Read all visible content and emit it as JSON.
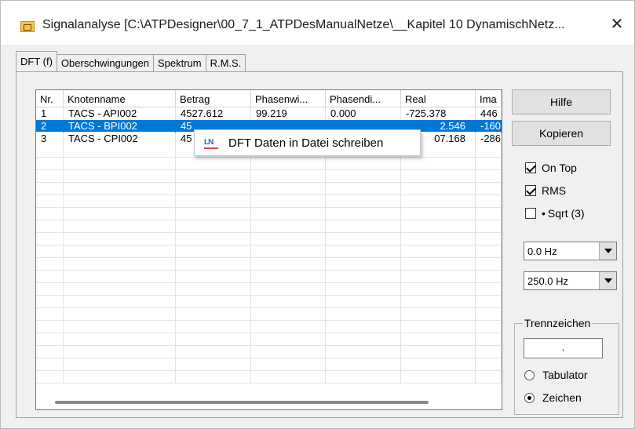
{
  "window": {
    "title": "Signalanalyse [C:\\ATPDesigner\\00_7_1_ATPDesManualNetze\\__Kapitel 10 DynamischNetz...",
    "close_symbol": "✕",
    "icon": "app-icon"
  },
  "tabs": [
    {
      "label": "DFT (f)",
      "active": true
    },
    {
      "label": "Oberschwingungen",
      "active": false
    },
    {
      "label": "Spektrum",
      "active": false
    },
    {
      "label": "R.M.S.",
      "active": false
    }
  ],
  "table": {
    "columns": [
      "Nr.",
      "Knotenname",
      "Betrag",
      "Phasenwi...",
      "Phasendi...",
      "Real",
      "Ima"
    ],
    "rows": [
      {
        "nr": "1",
        "name": "TACS - API002",
        "betrag": "4527.612",
        "phasenwinkel": "99.219",
        "phasendiff": "0.000",
        "real": "-725.378",
        "ima": "446"
      },
      {
        "nr": "2",
        "name": "TACS - BPI002",
        "betrag": "45",
        "phasenwinkel": "",
        "phasendiff": "",
        "real": "2.546",
        "ima": "-160",
        "selected": true
      },
      {
        "nr": "3",
        "name": "TACS - CPI002",
        "betrag": "45",
        "phasenwinkel": "",
        "phasendiff": "",
        "real": "07.168",
        "ima": "-286"
      }
    ]
  },
  "context_menu": {
    "item_label": "DFT Daten in Datei schreiben",
    "item_icon_text": "LN",
    "item_icon": "dft-file-icon"
  },
  "buttons": {
    "hilfe": "Hilfe",
    "kopieren": "Kopieren"
  },
  "checkboxes": {
    "on_top": {
      "label": "On Top",
      "checked": true
    },
    "rms": {
      "label": "RMS",
      "checked": true
    },
    "sqrt": {
      "label_dot": "•",
      "label": "Sqrt (3)",
      "checked": false
    }
  },
  "combos": {
    "freq_from": "0.0 Hz",
    "freq_to": "250.0 Hz"
  },
  "separator_group": {
    "title": "Trennzeichen",
    "value": ".",
    "options": [
      {
        "label": "Tabulator",
        "selected": false
      },
      {
        "label": "Zeichen",
        "selected": true
      }
    ]
  },
  "colors": {
    "selection": "#0078d7",
    "window_bg": "#f0f0f0"
  }
}
